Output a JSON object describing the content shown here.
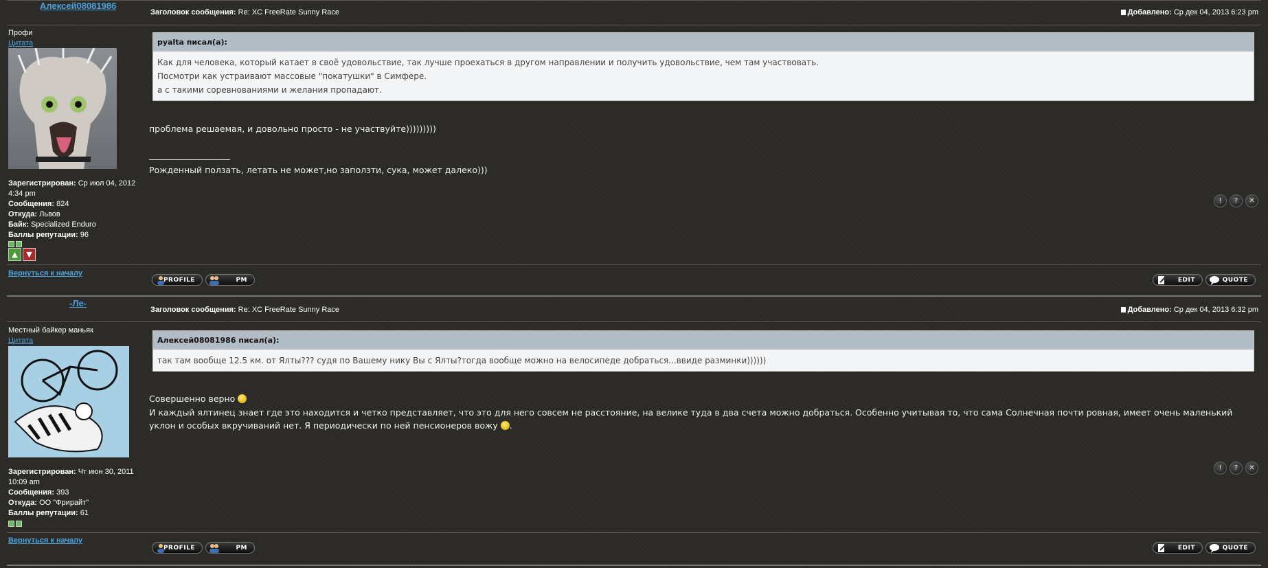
{
  "posts": [
    {
      "author": "Алексей08081986",
      "subject_label": "Заголовок сообщения:",
      "subject": "Re: XC FreeRate Sunny Race",
      "posted_label": "Добавлено:",
      "posted": "Ср дек 04, 2013 6:23 pm",
      "rank": "Профи",
      "quote_link": "Цитата",
      "profile": {
        "registered_label": "Зарегистрирован:",
        "registered": "Ср июл 04, 2012 4:34 pm",
        "posts_label": "Сообщения:",
        "posts": "824",
        "from_label": "Откуда:",
        "from": "Львов",
        "bike_label": "Байк:",
        "bike": "Specialized Enduro",
        "rep_label": "Баллы репутации:",
        "rep": "96"
      },
      "quote": {
        "author": "pyalta писал(а):",
        "line1": "Как для человека, который катает в своё удовольствие, так лучше проехаться в другом направлении и получить удовольствие, чем там участвовать.",
        "line2": "Посмотри как устраивают массовые \"покатушки\" в Симфере.",
        "line3": "а с такими соревнованиями и желания пропадают."
      },
      "message": "проблема решаемая, и довольно просто - не участвуйте)))))))))",
      "signature": "Рожденный ползать, летать не может,но заползти, сука, может далеко)))",
      "back_to_top": "Вернуться к началу",
      "buttons": {
        "profile": "PROFILE",
        "pm": "PM",
        "edit": "EDIT",
        "quote": "QUOTE"
      }
    },
    {
      "author": "-Ле-",
      "subject_label": "Заголовок сообщения:",
      "subject": "Re: XC FreeRate Sunny Race",
      "posted_label": "Добавлено:",
      "posted": "Ср дек 04, 2013 6:32 pm",
      "rank": "Местный байкер маньяк",
      "quote_link": "Цитата",
      "profile": {
        "registered_label": "Зарегистрирован:",
        "registered": "Чт июн 30, 2011 10:09 am",
        "posts_label": "Сообщения:",
        "posts": "393",
        "from_label": "Откуда:",
        "from": "ОО \"Фрирайт\"",
        "rep_label": "Баллы репутации:",
        "rep": "61"
      },
      "quote": {
        "author": "Алексей08081986 писал(а):",
        "line1": "так там вообще 12.5 км. от Ялты??? судя по Вашему нику Вы с Ялты?тогда вообще можно на велосипеде добраться...ввиде разминки))))))"
      },
      "message1": "Совершенно верно",
      "message2": "И каждый ялтинец знает где это находится и четко представляет, что это для него совсем не расстояние, на велике туда в два счета можно добраться. Особенно учитывая то, что сама Солнечная почти ровная, имеет очень маленький уклон и особых вкручиваний нет. Я периодически по ней пенсионеров вожу",
      "back_to_top": "Вернуться к началу",
      "buttons": {
        "profile": "PROFILE",
        "pm": "PM",
        "edit": "EDIT",
        "quote": "QUOTE"
      }
    }
  ],
  "icons": {
    "report": "report-icon",
    "info": "info-icon",
    "delete": "delete-icon",
    "smile": "smile-icon"
  }
}
